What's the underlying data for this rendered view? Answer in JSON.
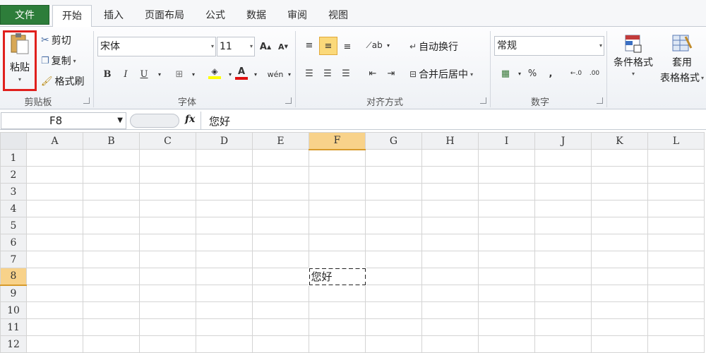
{
  "tabs": {
    "file": "文件",
    "items": [
      "开始",
      "插入",
      "页面布局",
      "公式",
      "数据",
      "审阅",
      "视图"
    ]
  },
  "clipboard": {
    "paste": "粘贴",
    "cut": "剪切",
    "copy": "复制",
    "format_painter": "格式刷",
    "group_label": "剪贴板"
  },
  "font": {
    "name": "宋体",
    "size": "11",
    "group_label": "字体"
  },
  "alignment": {
    "wrap_text": "自动换行",
    "merge_center": "合并后居中",
    "group_label": "对齐方式"
  },
  "number": {
    "format": "常规",
    "group_label": "数字"
  },
  "styles": {
    "conditional_format": "条件格式",
    "table_format_1": "套用",
    "table_format_2": "表格格式"
  },
  "formula_bar": {
    "name_box": "F8",
    "fx": "fx",
    "content": "您好"
  },
  "sheet": {
    "columns": [
      "A",
      "B",
      "C",
      "D",
      "E",
      "F",
      "G",
      "H",
      "I",
      "J",
      "K",
      "L"
    ],
    "rows": [
      "1",
      "2",
      "3",
      "4",
      "5",
      "6",
      "7",
      "8",
      "9",
      "10",
      "11",
      "12"
    ],
    "active_cell": "F8",
    "cell_F8": "您好"
  },
  "colors": {
    "file_tab": "#2d7d3a",
    "highlight": "#e0201d",
    "selected_header": "#f8d28a"
  }
}
